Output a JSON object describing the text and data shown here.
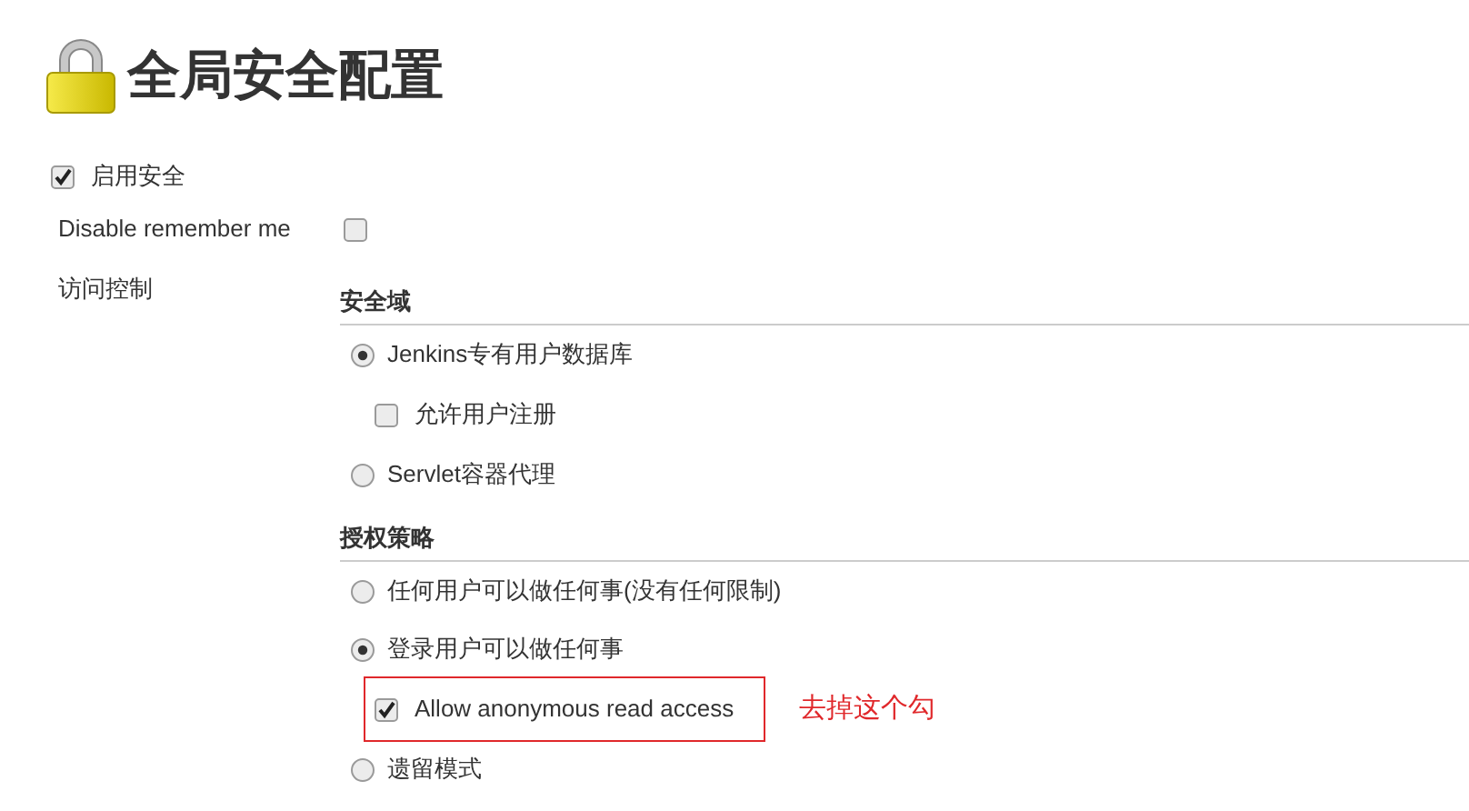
{
  "title": "全局安全配置",
  "enable_security": {
    "label": "启用安全",
    "checked": true
  },
  "disable_remember_me": {
    "label": "Disable remember me",
    "checked": false
  },
  "access_control": {
    "label": "访问控制",
    "sections": [
      {
        "heading": "安全域",
        "options": [
          {
            "kind": "radio",
            "label": "Jenkins专有用户数据库",
            "selected": true,
            "children": [
              {
                "kind": "checkbox",
                "label": "允许用户注册",
                "checked": false,
                "highlighted": false
              }
            ]
          },
          {
            "kind": "radio",
            "label": "Servlet容器代理",
            "selected": false
          }
        ]
      },
      {
        "heading": "授权策略",
        "options": [
          {
            "kind": "radio",
            "label": "任何用户可以做任何事(没有任何限制)",
            "selected": false
          },
          {
            "kind": "radio",
            "label": "登录用户可以做任何事",
            "selected": true,
            "children": [
              {
                "kind": "checkbox",
                "label": "Allow anonymous read access",
                "checked": true,
                "highlighted": true,
                "annotation": "去掉这个勾"
              }
            ]
          },
          {
            "kind": "radio",
            "label": "遗留模式",
            "selected": false
          }
        ]
      }
    ]
  }
}
